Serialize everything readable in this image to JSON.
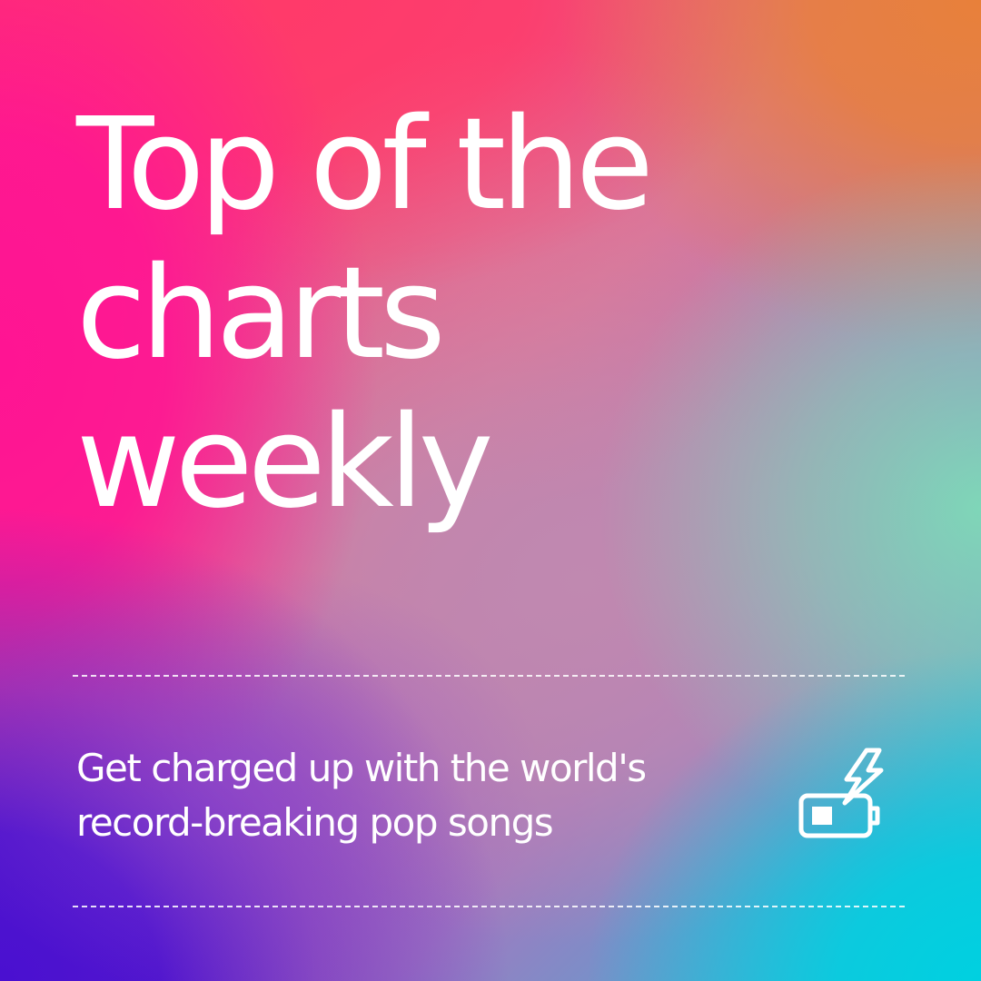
{
  "headline": {
    "lines": [
      "Top of the",
      "charts",
      "weekly"
    ]
  },
  "subtitle": {
    "lines": [
      "Get charged up with the world's",
      "record-breaking pop songs"
    ]
  },
  "icons": {
    "charge": "battery-charging-icon"
  },
  "colors": {
    "text": "#ffffff",
    "gradient_top_left": "#ff2d6f",
    "gradient_top_right": "#e8803a",
    "gradient_right": "#7fd6b8",
    "gradient_bottom_right": "#00d0e0",
    "gradient_bottom_left": "#4a10d0",
    "gradient_left": "#ff1493"
  }
}
